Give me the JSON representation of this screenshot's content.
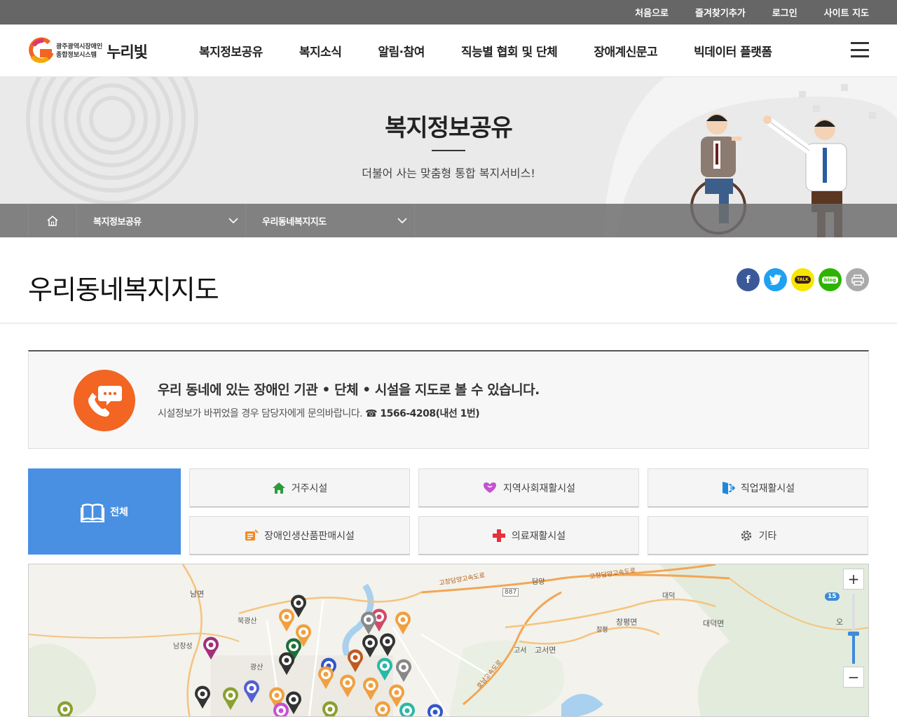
{
  "util_links": [
    "처음으로",
    "즐겨찾기추가",
    "로그인",
    "사이트 지도"
  ],
  "logo": {
    "sub_line1": "광주광역시장애인",
    "sub_line2": "종합정보시스템",
    "name": "누리빛"
  },
  "gnb": [
    "복지정보공유",
    "복지소식",
    "알림·참여",
    "직능별 협회 및 단체",
    "장애계신문고",
    "빅데이터 플랫폼"
  ],
  "visual": {
    "title": "복지정보공유",
    "subtitle": "더불어 사는 맞춤형 통합 복지서비스!"
  },
  "location": {
    "depth1": "복지정보공유",
    "depth2": "우리동네복지지도"
  },
  "page_title": "우리동네복지지도",
  "share": {
    "kakao_label": "TALK",
    "blog_label": "blog"
  },
  "info": {
    "line1": "우리 동네에 있는 장애인 기관 • 단체 • 시설을 지도로 볼 수 있습니다.",
    "line2_prefix": "시설정보가 바뀌었을 경우 담당자에게 문의바랍니다.",
    "phone": "☎ 1566-4208(내선 1번)"
  },
  "categories": {
    "all": "전체",
    "items": [
      "거주시설",
      "지역사회재활시설",
      "직업재활시설",
      "장애인생산품판매시설",
      "의료재활시설",
      "기타"
    ]
  },
  "map": {
    "labels": [
      "남면",
      "북광산",
      "남창성",
      "광산",
      "담양",
      "고창담양고속도로",
      "고창담양고속도로",
      "대덕",
      "창평면",
      "창평",
      "대덕면",
      "고서",
      "고서면",
      "오",
      "887",
      "호남고속도로"
    ],
    "zoom_level": "15",
    "zoom_in": "+",
    "zoom_out": "−"
  },
  "colors": {
    "orange": "#f26522",
    "blue": "#4a90e2",
    "facebook": "#3b5998",
    "twitter": "#1da1f2",
    "kakao": "#f7e600",
    "blog": "#2db400",
    "print": "#999999"
  }
}
